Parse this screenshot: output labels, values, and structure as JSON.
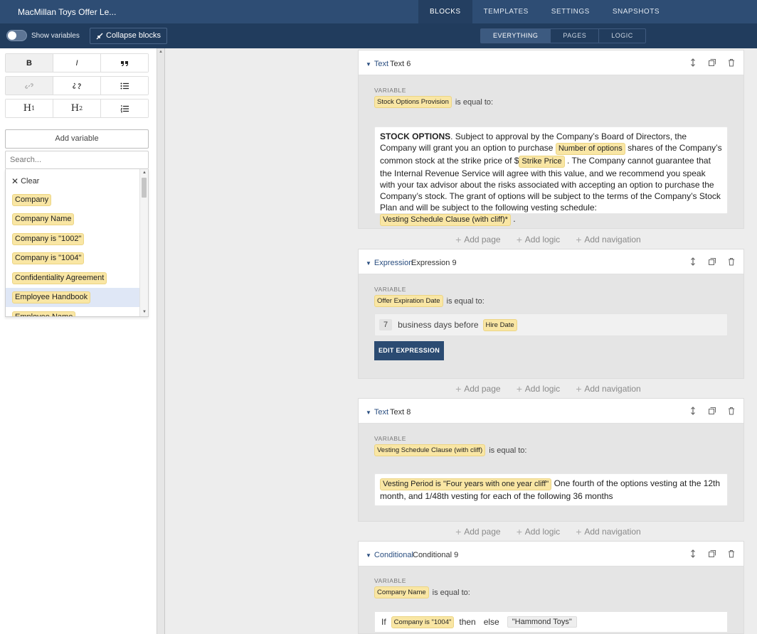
{
  "app": {
    "title": "MacMillan Toys Offer Le..."
  },
  "top_tabs": [
    {
      "label": "BLOCKS",
      "active": true
    },
    {
      "label": "TEMPLATES",
      "active": false
    },
    {
      "label": "SETTINGS",
      "active": false
    },
    {
      "label": "SNAPSHOTS",
      "active": false
    }
  ],
  "subbar": {
    "show_variables_label": "Show variables",
    "collapse_label": "Collapse blocks",
    "filter_tabs": [
      {
        "label": "EVERYTHING",
        "active": true
      },
      {
        "label": "PAGES",
        "active": false
      },
      {
        "label": "LOGIC",
        "active": false
      }
    ]
  },
  "editor": {
    "format_buttons": {
      "bold": "B",
      "italic": "I",
      "h1": "H",
      "h1_sub": "1",
      "h2": "H",
      "h2_sub": "2"
    },
    "add_variable_label": "Add variable",
    "search_placeholder": "Search...",
    "clear_label": "Clear",
    "variable_options": [
      "Company",
      "Company Name",
      "Company is \"1002\"",
      "Company is \"1004\"",
      "Confidentiality Agreement",
      "Employee Handbook",
      "Employee Name"
    ],
    "selected_option": "Employee Handbook"
  },
  "add_actions": {
    "page": "Add page",
    "logic": "Add logic",
    "navigation": "Add navigation"
  },
  "blocks": {
    "text6": {
      "type": "Text",
      "name": "Text 6",
      "var_label": "VARIABLE",
      "variable": "Stock Options Provision",
      "equal_label": "is equal to:",
      "p1_bold": "STOCK OPTIONS",
      "p1": ". Subject to approval by the Company’s Board of Directors, the Company will grant you an option to purchase",
      "pill1": "Number of options",
      "p2": "shares of the Company’s common stock at the strike price of $",
      "pill2": "Strike Price",
      "p3": ". The Company cannot guarantee that the Internal Revenue Service will agree with this value, and we recommend you speak with your tax advisor about the risks associated with accepting an option to purchase the Company’s stock. The grant of options will be subject to the terms of the Company’s Stock Plan and will be subject to the following vesting schedule:",
      "pill3": "Vesting Schedule Clause (with cliff)*",
      "p4": "."
    },
    "expr9": {
      "type": "Expression",
      "name": "Expression 9",
      "var_label": "VARIABLE",
      "variable": "Offer Expiration Date",
      "equal_label": "is equal to:",
      "number": "7",
      "unit_text": "business days before",
      "ref": "Hire Date",
      "edit_label": "EDIT EXPRESSION"
    },
    "text8": {
      "type": "Text",
      "name": "Text 8",
      "var_label": "VARIABLE",
      "variable": "Vesting Schedule Clause (with cliff)",
      "equal_label": "is equal to:",
      "pill": "Vesting Period is \"Four years with one year cliff\"",
      "text": "One fourth of the options vesting at the 12th month, and 1/48th vesting for each of the following 36 months"
    },
    "cond9": {
      "type": "Conditional",
      "name": "Conditional 9",
      "var_label": "VARIABLE",
      "variable": "Company Name",
      "equal_label": "is equal to:",
      "if_label": "If",
      "condition": "Company is \"1004\"",
      "then_label": "then",
      "else_label": "else",
      "else_value": "\"Hammond Toys\""
    }
  }
}
